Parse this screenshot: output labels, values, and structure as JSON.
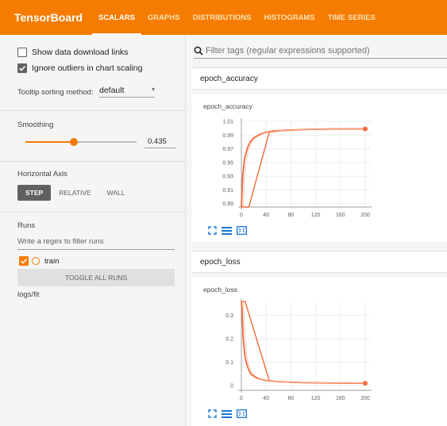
{
  "app": {
    "title": "TensorBoard"
  },
  "nav": {
    "tabs": [
      "SCALARS",
      "GRAPHS",
      "DISTRIBUTIONS",
      "HISTOGRAMS",
      "TIME SERIES"
    ],
    "active": 0
  },
  "sidebar": {
    "show_download": {
      "label": "Show data download links",
      "checked": false
    },
    "ignore_outliers": {
      "label": "Ignore outliers in chart scaling",
      "checked": true
    },
    "tooltip": {
      "label": "Tooltip sorting method:",
      "value": "default"
    },
    "smoothing": {
      "label": "Smoothing",
      "value": "0.435",
      "fraction": 0.435
    },
    "horizontal_axis": {
      "label": "Horizontal Axis",
      "options": [
        "STEP",
        "RELATIVE",
        "WALL"
      ],
      "active": 0
    },
    "runs": {
      "label": "Runs",
      "placeholder": "Write a regex to filter runs",
      "run_name": "train",
      "toggle_label": "TOGGLE ALL RUNS",
      "logdir": "logs/fit"
    }
  },
  "main": {
    "filter_placeholder": "Filter tags (regular expressions supported)",
    "groups": [
      {
        "header": "epoch_accuracy",
        "card_title": "epoch_accuracy"
      },
      {
        "header": "epoch_loss",
        "card_title": "epoch_loss"
      }
    ]
  },
  "colors": {
    "accent": "#f57c00",
    "line": "#f26b3a",
    "line_light": "#f7b9a3"
  },
  "icons": [
    "search-icon",
    "expand-icon",
    "data-table-icon",
    "fit-domain-icon",
    "check-icon"
  ],
  "chart_data": [
    {
      "type": "line",
      "title": "epoch_accuracy",
      "xlim": [
        0,
        200
      ],
      "ylim": [
        0.885,
        1.01
      ],
      "x_ticks": [
        0,
        40,
        80,
        120,
        160,
        200
      ],
      "x_tick_labels": [
        "0",
        "40",
        "80",
        "120",
        "160",
        "200"
      ],
      "y_ticks": [
        1.01,
        0.99,
        0.97,
        0.95,
        0.93,
        0.91,
        0.89
      ],
      "y_tick_labels": [
        "1.01",
        "0.99",
        "0.97",
        "0.95",
        "0.93",
        "0.91",
        "0.89"
      ],
      "series": [
        {
          "role": "smoothed",
          "x": [
            0,
            2,
            5,
            10,
            15,
            20,
            30,
            40,
            50,
            70,
            100,
            150,
            200
          ],
          "y": [
            0.885,
            0.93,
            0.955,
            0.972,
            0.981,
            0.986,
            0.991,
            0.994,
            0.996,
            0.997,
            0.998,
            0.999,
            0.999
          ]
        },
        {
          "role": "raw",
          "x": [
            0,
            2,
            5,
            8,
            12,
            45,
            60,
            100,
            150,
            200
          ],
          "y": [
            0.885,
            0.885,
            0.885,
            0.885,
            0.885,
            0.994,
            0.996,
            0.998,
            0.999,
            0.999
          ]
        }
      ]
    },
    {
      "type": "line",
      "title": "epoch_loss",
      "xlim": [
        0,
        200
      ],
      "ylim": [
        -0.02,
        0.36
      ],
      "x_ticks": [
        0,
        40,
        80,
        120,
        160,
        200
      ],
      "x_tick_labels": [
        "0",
        "40",
        "80",
        "120",
        "160",
        "200"
      ],
      "y_ticks": [
        0.3,
        0.2,
        0.1,
        0
      ],
      "y_tick_labels": [
        "0.3",
        "0.2",
        "0.1",
        "0"
      ],
      "series": [
        {
          "role": "smoothed",
          "x": [
            0,
            1,
            3,
            6,
            10,
            15,
            25,
            40,
            60,
            100,
            150,
            200
          ],
          "y": [
            0.36,
            0.33,
            0.2,
            0.12,
            0.08,
            0.05,
            0.032,
            0.022,
            0.017,
            0.013,
            0.011,
            0.01
          ]
        },
        {
          "role": "raw",
          "x": [
            0,
            2,
            4,
            6,
            45,
            60,
            100,
            150,
            200
          ],
          "y": [
            0.36,
            0.36,
            0.36,
            0.36,
            0.022,
            0.017,
            0.013,
            0.011,
            0.01
          ]
        }
      ]
    }
  ]
}
